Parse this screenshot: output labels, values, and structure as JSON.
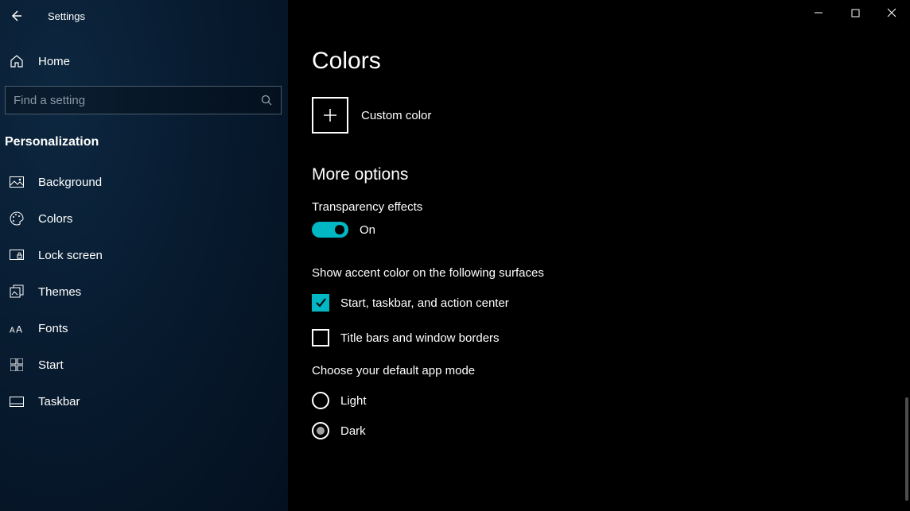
{
  "titlebar": {
    "title": "Settings"
  },
  "sidebar": {
    "home_label": "Home",
    "search_placeholder": "Find a setting",
    "section_header": "Personalization",
    "items": [
      {
        "label": "Background"
      },
      {
        "label": "Colors"
      },
      {
        "label": "Lock screen"
      },
      {
        "label": "Themes"
      },
      {
        "label": "Fonts"
      },
      {
        "label": "Start"
      },
      {
        "label": "Taskbar"
      }
    ]
  },
  "content": {
    "page_title": "Colors",
    "custom_color_label": "Custom color",
    "more_options_header": "More options",
    "transparency": {
      "label": "Transparency effects",
      "state": "On"
    },
    "accent_surfaces": {
      "label": "Show accent color on the following surfaces",
      "opt1": "Start, taskbar, and action center",
      "opt2": "Title bars and window borders"
    },
    "app_mode": {
      "label": "Choose your default app mode",
      "light": "Light",
      "dark": "Dark"
    }
  }
}
